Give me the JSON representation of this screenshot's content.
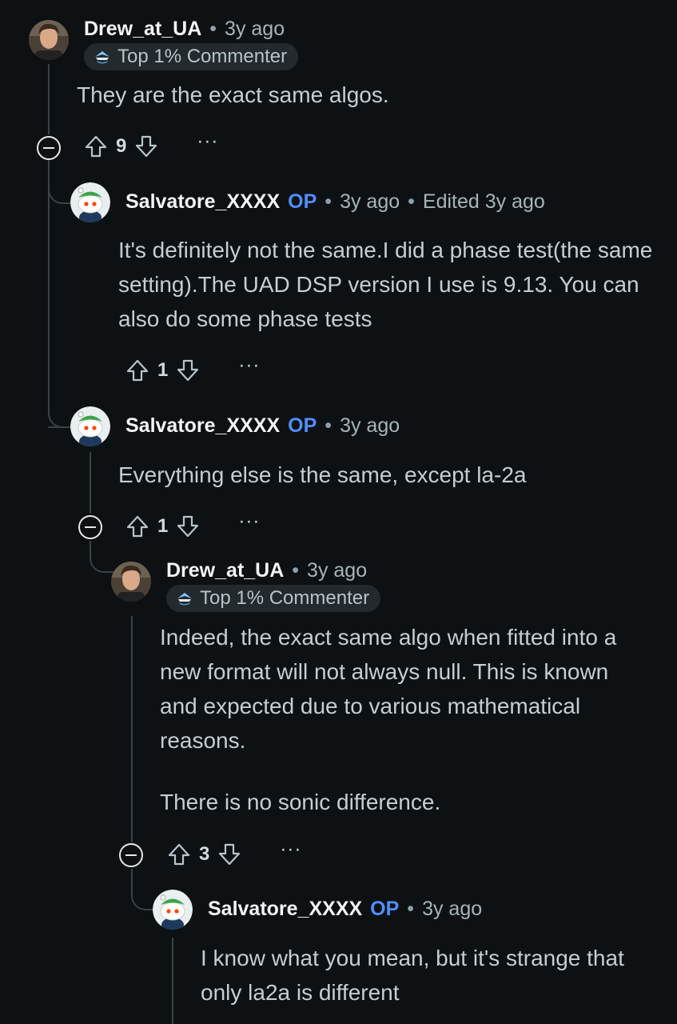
{
  "comments": [
    {
      "username": "Drew_at_UA",
      "op": "",
      "time": "3y ago",
      "edited": "",
      "badge": "Top 1% Commenter",
      "body": [
        "They are the exact same algos."
      ],
      "votes": "9",
      "more": "···"
    },
    {
      "username": "Salvatore_XXXX",
      "op": "OP",
      "time": "3y ago",
      "edited": "Edited 3y ago",
      "badge": "",
      "body": [
        "It's definitely not the same.I did a phase test(the same setting).The UAD DSP version I use is 9.13. You can also do some phase tests"
      ],
      "votes": "1",
      "more": "···"
    },
    {
      "username": "Salvatore_XXXX",
      "op": "OP",
      "time": "3y ago",
      "edited": "",
      "badge": "",
      "body": [
        "Everything else is the same, except la-2a"
      ],
      "votes": "1",
      "more": "···"
    },
    {
      "username": "Drew_at_UA",
      "op": "",
      "time": "3y ago",
      "edited": "",
      "badge": "Top 1% Commenter",
      "body": [
        "Indeed, the exact same algo when fitted into a new format will not always null. This is known and expected due to various mathematical reasons.",
        "There is no sonic difference."
      ],
      "votes": "3",
      "more": "···"
    },
    {
      "username": "Salvatore_XXXX",
      "op": "OP",
      "time": "3y ago",
      "edited": "",
      "badge": "",
      "body": [
        "I know what you mean, but it's strange that only la2a is different"
      ],
      "votes": "",
      "more": ""
    }
  ],
  "separator": "•",
  "icons": {
    "upvote": "upvote-icon",
    "downvote": "downvote-icon",
    "collapse": "collapse-icon",
    "badge": "top-commenter-badge-icon"
  },
  "colors": {
    "background": "#0e1113",
    "username": "#f2f4f5",
    "op": "#4f8ff7",
    "text": "#c4ced3",
    "thread_line": "#3a4246"
  }
}
